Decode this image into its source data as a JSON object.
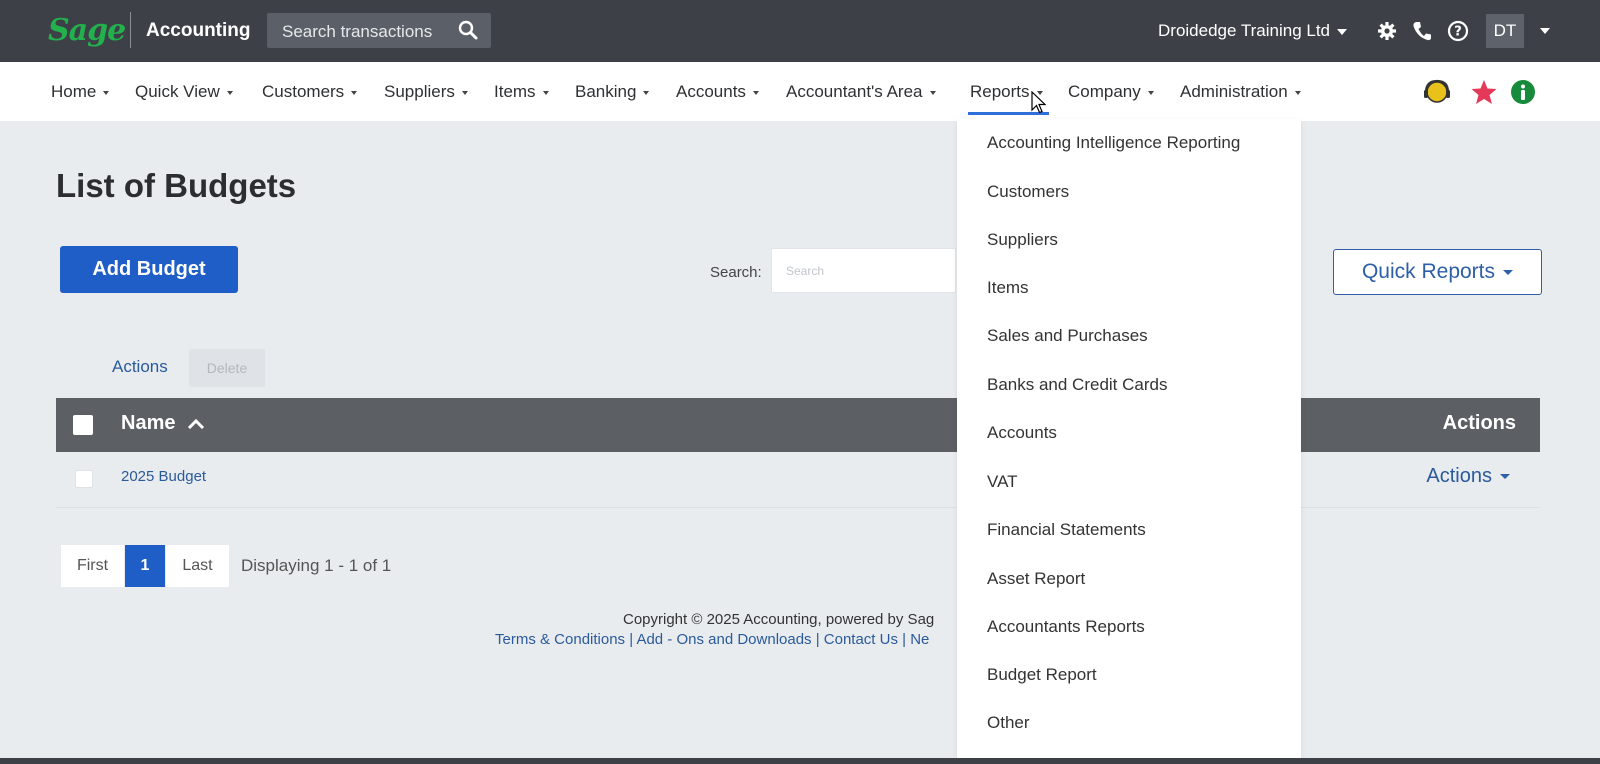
{
  "topbar": {
    "logo": "Sage",
    "app_name": "Accounting",
    "search_placeholder": "Search transactions",
    "company": "Droidedge Training Ltd",
    "avatar": "DT",
    "icons": [
      "settings-icon",
      "phone-icon",
      "help-icon"
    ]
  },
  "nav": {
    "items": [
      "Home",
      "Quick View",
      "Customers",
      "Suppliers",
      "Items",
      "Banking",
      "Accounts",
      "Accountant's Area",
      "Reports",
      "Company",
      "Administration"
    ],
    "active": "Reports",
    "right_icons": [
      "support-headset-icon",
      "favourites-star-icon",
      "info-icon"
    ]
  },
  "page": {
    "title": "List of Budgets",
    "add_button": "Add Budget",
    "search_label": "Search:",
    "search_placeholder": "Search",
    "quick_reports": "Quick Reports",
    "actions_link": "Actions",
    "delete_button": "Delete"
  },
  "table": {
    "columns": [
      "Name",
      "Actions"
    ],
    "rows": [
      {
        "name": "2025 Budget",
        "actions": "Actions"
      }
    ]
  },
  "pager": {
    "first": "First",
    "current": "1",
    "last": "Last",
    "info": "Displaying 1 - 1 of 1"
  },
  "footer": {
    "copyright": "Copyright © 2025 Accounting, powered by Sag",
    "links": "Terms & Conditions | Add - Ons and Downloads | Contact Us | Ne"
  },
  "reports_menu": {
    "items": [
      "Accounting Intelligence Reporting",
      "Customers",
      "Suppliers",
      "Items",
      "Sales and Purchases",
      "Banks and Credit Cards",
      "Accounts",
      "VAT",
      "Financial Statements",
      "Asset Report",
      "Accountants Reports",
      "Budget Report",
      "Other"
    ]
  },
  "colors": {
    "topbar": "#3d4147",
    "brand_green": "#22b14c",
    "primary_blue": "#1f5dc7",
    "link_blue": "#2a5a9c",
    "table_header": "#5c5f63"
  }
}
